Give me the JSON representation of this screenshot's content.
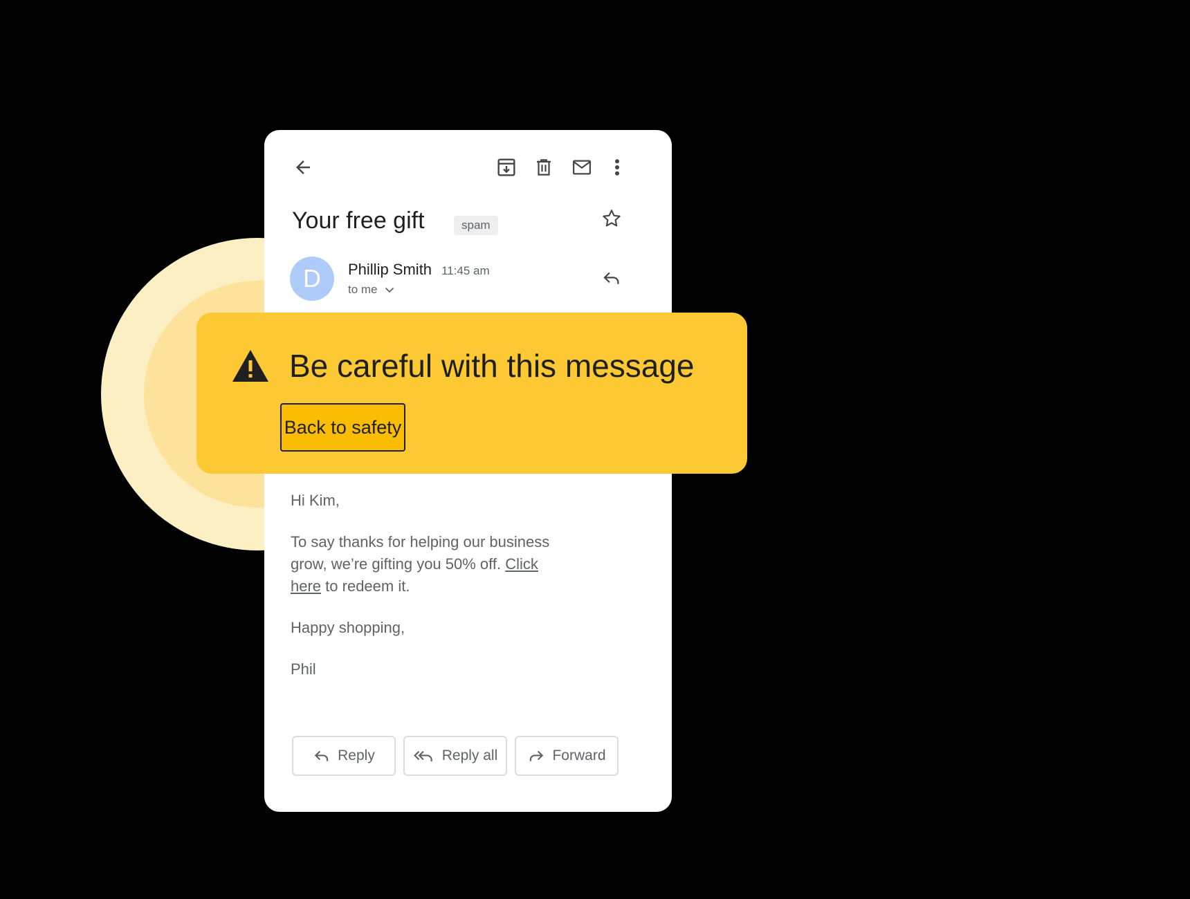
{
  "toolbar": {
    "back_icon": "arrow-left-icon",
    "archive_icon": "archive-icon",
    "delete_icon": "trash-icon",
    "mark_unread_icon": "envelope-icon",
    "more_icon": "more-vert-icon"
  },
  "email": {
    "subject": "Your free gift",
    "label": "spam",
    "starred": false,
    "sender": {
      "initial": "D",
      "name": "Phillip Smith",
      "time": "11:45 am",
      "recipient": "to me",
      "avatar_color": "#aecbfa"
    },
    "greeting": "Hi Kim,",
    "body_before_link": "To say thanks for helping our business grow, we’re gifting you 50% off.",
    "link_text": "Click here",
    "body_after_link": "to redeem it.",
    "closing": "Happy shopping,",
    "signature": "Phil"
  },
  "warning": {
    "icon": "warning-triangle-icon",
    "title": "Be careful with this message",
    "action_label": "Back to safety",
    "background_color": "#fcc934"
  },
  "actions": {
    "reply_label": "Reply",
    "reply_all_label": "Reply all",
    "forward_label": "Forward"
  }
}
